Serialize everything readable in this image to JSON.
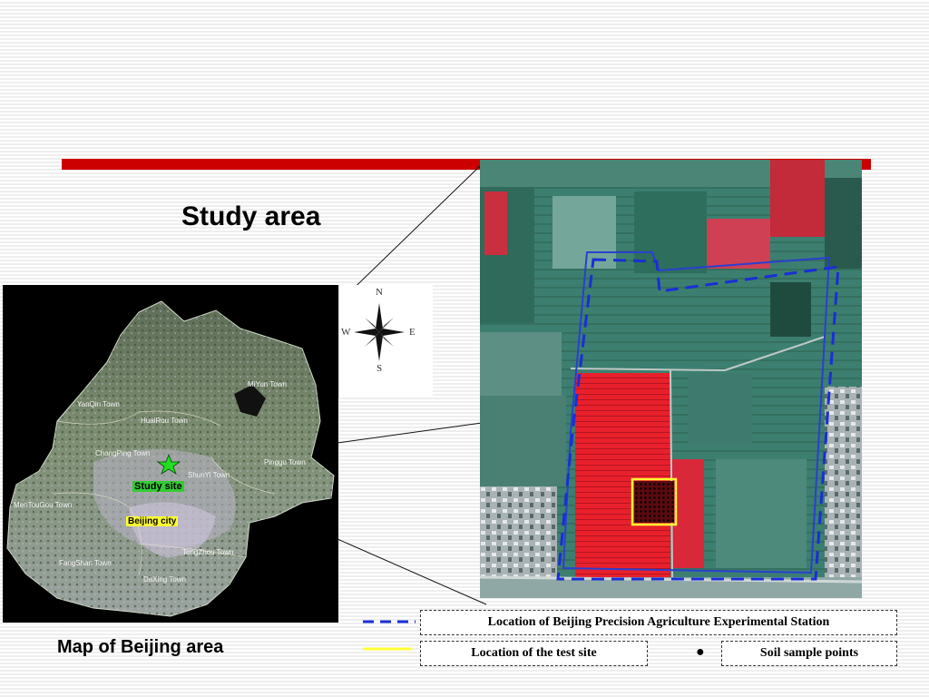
{
  "slide": {
    "title": "Study area",
    "map_caption": "Map of Beijing area"
  },
  "map": {
    "towns": [
      "YanQin Town",
      "HuaiRou Town",
      "MiYun Town",
      "ChangPing Town",
      "ShunYi Town",
      "Pinggu Town",
      "MenTouGou Town",
      "TongZhou Town",
      "FangShan Town",
      "DaXing Town"
    ],
    "study_site_label": "Study site",
    "beijing_label": "Beijing city",
    "compass": {
      "n": "N",
      "s": "S",
      "e": "E",
      "w": "W"
    }
  },
  "legend": {
    "station": "Location of Beijing Precision Agriculture Experimental Station",
    "test_site": "Location of the test site",
    "soil_points": "Soil sample points",
    "colors": {
      "station_line": "#1a2ed6",
      "test_site_line": "#ffff33",
      "title_bar": "#cc0000",
      "study_star": "#22dd22"
    }
  }
}
